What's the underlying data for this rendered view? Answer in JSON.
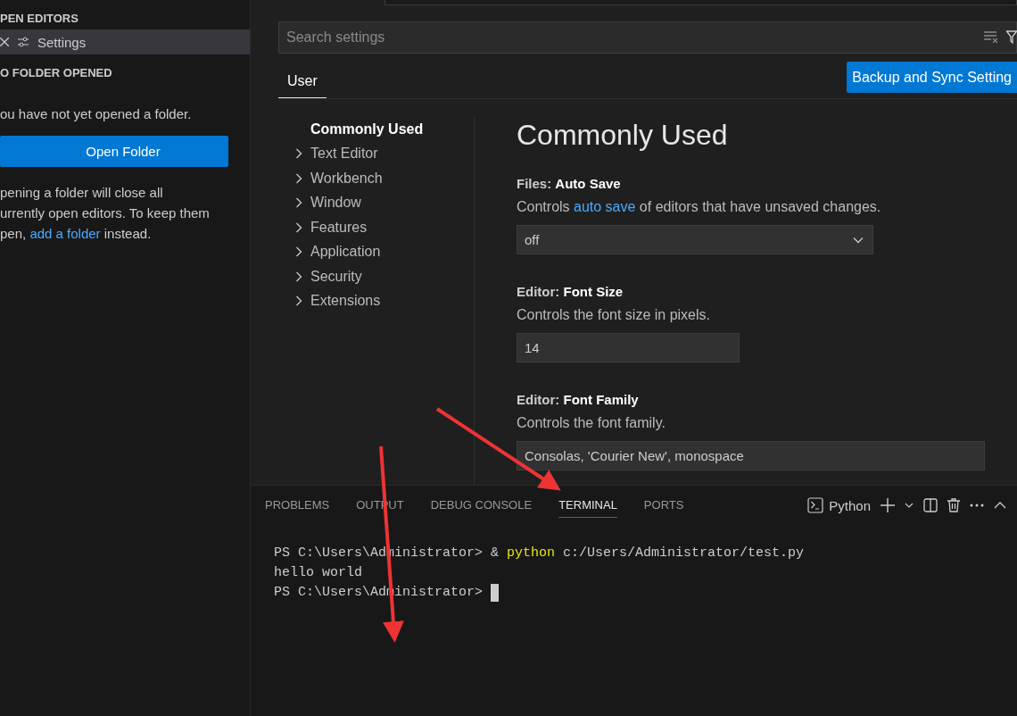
{
  "sidebar": {
    "open_editors_header": "PEN EDITORS",
    "open_editors": [
      {
        "label": "Settings",
        "selected": true
      }
    ],
    "folder_header": "O FOLDER OPENED",
    "message": "ou have not yet opened a folder.",
    "open_button": "Open Folder",
    "hint": {
      "lines": [
        "pening a folder will close all",
        "urrently open editors. To keep them"
      ],
      "before": "pen, ",
      "link": "add a folder",
      "after": " instead."
    }
  },
  "settings": {
    "search": {
      "placeholder": "Search settings"
    },
    "tabs": [
      {
        "label": "User",
        "selected": true
      }
    ],
    "sync_button": "Backup and Sync Setting",
    "tree": [
      {
        "label": "Commonly Used",
        "selected": true,
        "expandable": false
      },
      {
        "label": "Text Editor",
        "selected": false,
        "expandable": true
      },
      {
        "label": "Workbench",
        "selected": false,
        "expandable": true
      },
      {
        "label": "Window",
        "selected": false,
        "expandable": true
      },
      {
        "label": "Features",
        "selected": false,
        "expandable": true
      },
      {
        "label": "Application",
        "selected": false,
        "expandable": true
      },
      {
        "label": "Security",
        "selected": false,
        "expandable": true
      },
      {
        "label": "Extensions",
        "selected": false,
        "expandable": true
      }
    ],
    "heading": "Commonly Used",
    "items": [
      {
        "kind": "dropdown",
        "category": "Files: ",
        "name": "Auto Save",
        "description": {
          "before": "Controls ",
          "link": "auto save",
          "after": " of editors that have unsaved changes."
        },
        "value": "off"
      },
      {
        "kind": "number",
        "category": "Editor: ",
        "name": "Font Size",
        "description": {
          "before": "Controls the font size in pixels."
        },
        "value": "14"
      },
      {
        "kind": "text",
        "category": "Editor: ",
        "name": "Font Family",
        "description": {
          "before": "Controls the font family."
        },
        "value": "Consolas, 'Courier New', monospace"
      }
    ]
  },
  "panel": {
    "tabs": [
      {
        "label": "PROBLEMS",
        "selected": false
      },
      {
        "label": "OUTPUT",
        "selected": false
      },
      {
        "label": "DEBUG CONSOLE",
        "selected": false
      },
      {
        "label": "TERMINAL",
        "selected": true
      },
      {
        "label": "PORTS",
        "selected": false
      }
    ],
    "terminal_name": "Python",
    "lines": [
      {
        "segments": [
          {
            "kind": "plain",
            "text": "PS C:\\Users\\Administrator> & "
          },
          {
            "kind": "highlight",
            "text": "python"
          },
          {
            "kind": "plain",
            "text": " c:/Users/Administrator/test.py"
          }
        ],
        "cursor": false
      },
      {
        "segments": [
          {
            "kind": "plain",
            "text": "hello world"
          }
        ],
        "cursor": false
      },
      {
        "segments": [
          {
            "kind": "plain",
            "text": "PS C:\\Users\\Administrator> "
          }
        ],
        "cursor": true
      }
    ]
  }
}
